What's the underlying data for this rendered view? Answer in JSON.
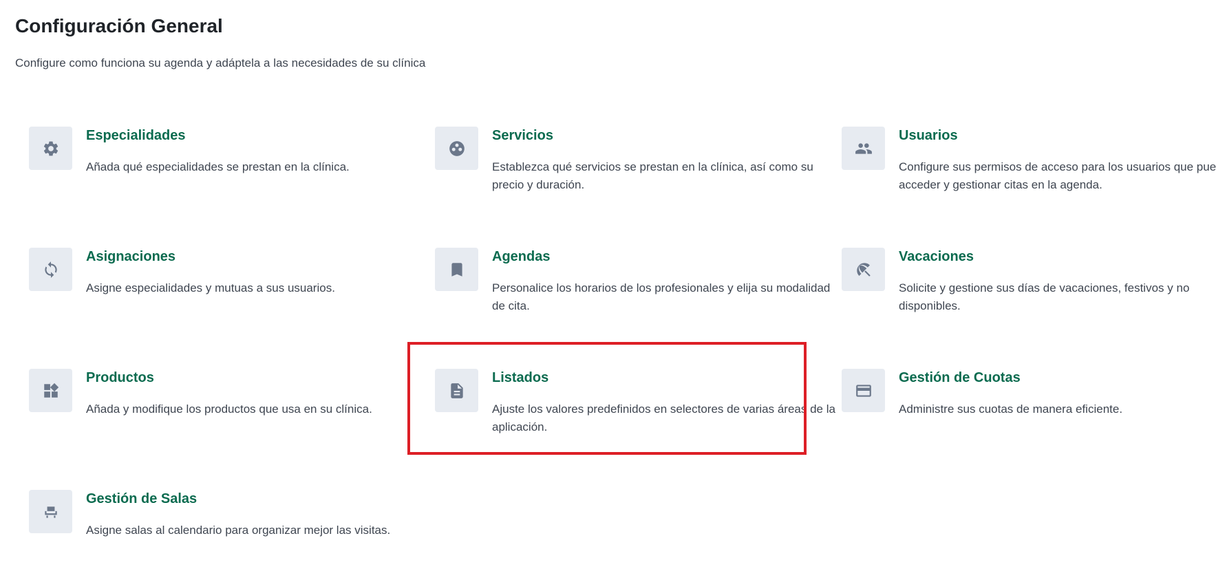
{
  "header": {
    "title": "Configuración General",
    "subtitle": "Configure como funciona su agenda y adáptela a las necesidades de su clínica"
  },
  "cards": [
    {
      "title": "Especialidades",
      "description": "Añada qué especialidades se prestan en la clínica.",
      "icon": "gear-icon"
    },
    {
      "title": "Servicios",
      "description": "Establezca qué servicios se prestan en la clínica, así como su precio y duración.",
      "icon": "service-icon"
    },
    {
      "title": "Usuarios",
      "description": "Configure sus permisos de acceso para los usuarios que pueden acceder y gestionar citas en la agenda.",
      "icon": "users-icon"
    },
    {
      "title": "Asignaciones",
      "description": "Asigne especialidades y mutuas a sus usuarios.",
      "icon": "sync-icon"
    },
    {
      "title": "Agendas",
      "description": "Personalice los horarios de los profesionales y elija su modalidad de cita.",
      "icon": "bookmark-icon"
    },
    {
      "title": "Vacaciones",
      "description": "Solicite y gestione sus días de vacaciones, festivos y no disponibles.",
      "icon": "beach-access-icon"
    },
    {
      "title": "Productos",
      "description": "Añada y modifique los productos que usa en su clínica.",
      "icon": "widgets-icon"
    },
    {
      "title": "Listados",
      "description": "Ajuste los valores predefinidos en selectores de varias áreas de la aplicación.",
      "icon": "document-icon"
    },
    {
      "title": "Gestión de Cuotas",
      "description": "Administre sus cuotas de manera eficiente.",
      "icon": "credit-card-icon"
    },
    {
      "title": "Gestión de Salas",
      "description": "Asigne salas al calendario para organizar mejor las visitas.",
      "icon": "chair-icon"
    }
  ],
  "colors": {
    "accent": "#0b6b4f",
    "icon_bg": "#e7ebf1",
    "icon_fg": "#6b778a",
    "highlight": "#dd1f26"
  }
}
